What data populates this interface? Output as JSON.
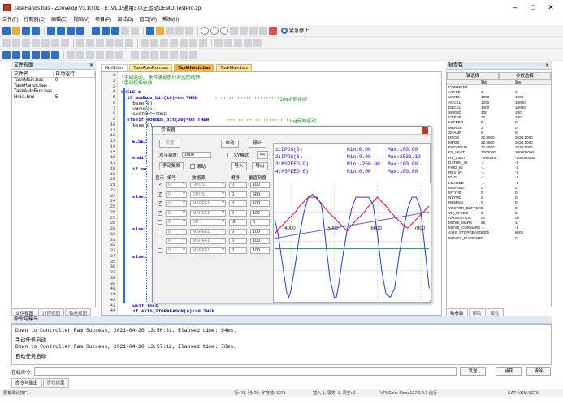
{
  "window": {
    "title": "TaskHands.bas - ZDevelop V3.10.01 - E:\\V1.1\\通用3.0\\正运动DEMO\\TestPro.zpj",
    "minimize": "–",
    "maximize": "□",
    "close": "✕"
  },
  "menu": [
    "文件(F)",
    "控制器(C)",
    "编辑(E)",
    "视图(V)",
    "项目(P)",
    "调试(D)",
    "窗口(W)",
    "帮助(H)"
  ],
  "toolbar": {
    "emergency_label": "紧急停止"
  },
  "file_panel": {
    "title": "文件视图",
    "close": "✕",
    "columns": [
      "文件名",
      "自动运行"
    ],
    "rows": [
      [
        "TaskMain.bas",
        "0"
      ],
      [
        "TaskHands.bas",
        ""
      ],
      [
        "TaskAutoRun.bas",
        ""
      ],
      [
        "Hmi1.hmi",
        "5"
      ]
    ]
  },
  "file_tabs": [
    "文件视图",
    "过程视图",
    "轴参视图"
  ],
  "editor_tabs": [
    "Hmi1.hmi",
    "TaskAutoRun.bas",
    "TaskHands.bas",
    "TaskMain.bas"
  ],
  "editor": {
    "line_numbers": [
      "1",
      "2",
      "3",
      "4",
      "5",
      "6",
      "7",
      "8",
      "9",
      "10",
      "11",
      "12",
      "13",
      "14",
      "15",
      "16",
      "17",
      "18",
      "19",
      "20",
      "21",
      "22",
      "23",
      "24",
      "25",
      "26",
      "27",
      "28",
      "29",
      "30",
      "31",
      "32",
      "33",
      "34",
      "35",
      "36",
      "37",
      "38",
      "39",
      "40",
      "41",
      "42",
      "43",
      "44"
    ],
    "lines": [
      {
        "text": "'手动运动, 条件满足执行对应的动作",
        "cls": "cm",
        "line": 1,
        "indent": 0
      },
      {
        "text": "'手动任务启动",
        "cls": "cm",
        "line": 2,
        "indent": 0
      },
      {
        "text": "WHILE 1",
        "cls": "kw",
        "line": 4,
        "indent": 0
      },
      {
        "text": "if modbus_bit(10)=on THEN",
        "cls": "kw",
        "line": 5,
        "indent": 1
      },
      {
        "text": "'''''''''''''''''''''''Jog正向运动",
        "cls": "cm",
        "line": 5,
        "indent": 32
      },
      {
        "text": "base(0)",
        "cls": "",
        "line": 6,
        "indent": 2
      },
      {
        "text": "VMOVE(1)",
        "cls": "",
        "line": 7,
        "indent": 2
      },
      {
        "text": "SYSTEMP=TRUE",
        "cls": "",
        "line": 8,
        "indent": 2
      },
      {
        "text": "elseif modbus_bit(20)=on THEN",
        "cls": "kw",
        "line": 9,
        "indent": 1
      },
      {
        "text": "''''''''''''''''''''''Jog反向运动",
        "cls": "cm",
        "line": 9,
        "indent": 36
      },
      {
        "text": "base(0)",
        "cls": "",
        "line": 10,
        "indent": 2
      },
      {
        "text": "WAIT IDLE",
        "cls": "kw",
        "line": 43,
        "indent": 2
      },
      {
        "text": "if AXIS_STOPREASON(0)<>0 THEN",
        "cls": "kw",
        "line": 44,
        "indent": 2
      }
    ],
    "folded_labels": [
      {
        "text": "ELSEI",
        "line": 13
      },
      {
        "text": "endif",
        "line": 16
      },
      {
        "text": "if mo",
        "line": 18
      },
      {
        "text": "elsei",
        "line": 23
      },
      {
        "text": "elsei",
        "line": 29
      },
      {
        "text": "elsei",
        "line": 34
      }
    ]
  },
  "scope_dialog": {
    "title": "示波器",
    "settings_btn": "设置",
    "start_btn": "启动",
    "stop_btn": "停止",
    "hscale_label": "水平刻度:",
    "hscale_value": "1000",
    "xy_mode_label": "XY模式",
    "manual_trigger_btn": "手动触发",
    "scroll_label": "滚动",
    "import_btn": "导入",
    "export_btn": "导出",
    "nav_btn": "<<",
    "columns": [
      "显示",
      "编号",
      "数据源",
      "偏移",
      "垂直刻度"
    ],
    "channels": [
      {
        "on": true,
        "num": "0",
        "src": "DPOS",
        "offset": "0",
        "scale": "100"
      },
      {
        "on": true,
        "num": "0",
        "src": "DPOS",
        "offset": "0",
        "scale": "500"
      },
      {
        "on": true,
        "num": "0",
        "src": "MSPEED",
        "offset": "0",
        "scale": "100"
      },
      {
        "on": true,
        "num": "0",
        "src": "MSPEED",
        "offset": "0",
        "scale": "100"
      },
      {
        "on": false,
        "num": "0",
        "src": "DP",
        "offset": "-2",
        "scale": "0"
      },
      {
        "on": false,
        "num": "0",
        "src": "MSPEED",
        "offset": "0",
        "scale": "100"
      },
      {
        "on": false,
        "num": "0",
        "src": "MSPEED",
        "offset": "0",
        "scale": "100"
      },
      {
        "on": false,
        "num": "0",
        "src": "MSPEED",
        "offset": "0",
        "scale": "100"
      }
    ]
  },
  "chart_data": {
    "type": "line",
    "title": "",
    "xlabel": "",
    "ylabel": "",
    "x_ticks": [
      "4000",
      "5000",
      "6000",
      "7000"
    ],
    "xlim": [
      3600,
      7250
    ],
    "ylim": [
      -4,
      4
    ],
    "legend": [
      {
        "name": "1:DPOS(0)",
        "min": "Min:0.00",
        "max": "Max:100.00"
      },
      {
        "name": "2:DPOS(6)",
        "min": "Min:0.00",
        "max": "Max:2533.10"
      },
      {
        "name": "3:MSPEED(0)",
        "min": "Min:-250.00",
        "max": "Max:100.00"
      },
      {
        "name": "4:MSPEED(6)",
        "min": "Min:0.00",
        "max": "Max:100.80"
      }
    ],
    "series": [
      {
        "name": "1:DPOS(0)",
        "color": "#e0003c",
        "x": [
          3620,
          3700,
          3800,
          3900,
          4000,
          4100,
          4200,
          4300,
          4400,
          4500,
          4600,
          4700,
          4800,
          4900,
          5000,
          5100,
          5200,
          5300,
          5400,
          5500,
          5600,
          5700,
          5800,
          5900,
          6000,
          6100,
          6200,
          6300,
          6400,
          6500,
          6600,
          6700,
          6800,
          6900,
          7000,
          7100,
          7200
        ],
        "y": [
          0.5,
          0.8,
          1.1,
          1.4,
          1.7,
          2.0,
          2.4,
          2.7,
          3.0,
          3.2,
          2.9,
          2.6,
          2.2,
          1.9,
          1.6,
          1.3,
          1.0,
          0.7,
          1.1,
          1.4,
          1.7,
          2.0,
          2.4,
          2.7,
          3.0,
          2.7,
          2.4,
          2.0,
          1.7,
          1.4,
          1.1,
          0.9,
          1.2,
          1.5,
          1.8,
          2.1,
          2.4
        ]
      },
      {
        "name": "2:DPOS(6)",
        "color": "#6a5acd",
        "x": [
          3620,
          4200,
          4800,
          5400,
          6000,
          6600,
          7200
        ],
        "y": [
          0.2,
          0.5,
          0.8,
          1.1,
          1.4,
          1.7,
          2.0
        ]
      },
      {
        "name": "3:MSPEED(0)",
        "color": "#1f3fcf",
        "x": [
          3620,
          3700,
          3800,
          3900,
          3950,
          4000,
          4100,
          4200,
          4300,
          4400,
          4500,
          4600,
          4700,
          4750,
          4800,
          4900,
          5000,
          5050,
          5100,
          5200,
          5300,
          5400,
          5500,
          5600,
          5700,
          5800,
          5900,
          6000,
          6100,
          6200,
          6300,
          6400,
          6500,
          6600,
          6700,
          6800,
          6900,
          7000,
          7100,
          7200
        ],
        "y": [
          1.5,
          0.5,
          -1.5,
          -3.5,
          -3.8,
          -3.3,
          -1.5,
          0.5,
          2.0,
          3.0,
          3.0,
          3.0,
          2.5,
          1.5,
          0.0,
          -2.5,
          -3.8,
          -3.8,
          -3.0,
          -1.0,
          0.8,
          2.2,
          3.0,
          3.0,
          3.0,
          3.0,
          2.5,
          0.5,
          -2.0,
          -3.6,
          -3.8,
          -3.2,
          -1.0,
          0.8,
          2.2,
          3.0,
          3.0,
          2.2,
          -0.5,
          -3.2
        ]
      },
      {
        "name": "4:MSPEED(6)",
        "color": "#2e8b57",
        "x": [
          3620,
          4500,
          5400,
          6300,
          7200
        ],
        "y": [
          -0.5,
          -0.5,
          -0.5,
          -0.5,
          -0.5
        ]
      }
    ]
  },
  "param_panel": {
    "title": "轴参数",
    "close": "✕",
    "tabs": [
      "轴选择",
      "参数选择"
    ],
    "col_headers": [
      "",
      "轴0",
      "轴6"
    ],
    "rows": [
      [
        "COMMENT",
        "",
        ""
      ],
      [
        "ATYPE",
        "1",
        "0"
      ],
      [
        "UNITS",
        "1000",
        "1000"
      ],
      [
        "ACCEL",
        "1000",
        "10000"
      ],
      [
        "DECEL",
        "1000",
        "10000"
      ],
      [
        "SPEED",
        "100",
        "100"
      ],
      [
        "CREEP",
        "10",
        "100"
      ],
      [
        "LSPEED",
        "0",
        "0"
      ],
      [
        "MERGE",
        "1",
        "0"
      ],
      [
        "SRAMP",
        "0",
        "0"
      ],
      [
        "DPOS",
        "22.5500",
        "2633.1000"
      ],
      [
        "MPOS",
        "22.5500",
        "2633.1000"
      ],
      [
        "ENDMOVE",
        "22.5500",
        "2633.1000"
      ],
      [
        "FS_LIMIT",
        "2000000",
        "200000000"
      ],
      [
        "RS_LIMIT",
        "-2000000",
        "-200000000"
      ],
      [
        "DATUM_IN",
        "-1",
        "-1"
      ],
      [
        "FWD_IN",
        "-1",
        "-1"
      ],
      [
        "REV_IN",
        "-1",
        "-1"
      ],
      [
        "IDLE",
        "-1",
        "-1"
      ],
      [
        "LOADED",
        "-1",
        "-1"
      ],
      [
        "MSPEED",
        "0",
        "0"
      ],
      [
        "MTYPE",
        "0",
        "0"
      ],
      [
        "NTYPE",
        "0",
        "0"
      ],
      [
        "REMAIN",
        "0",
        "0"
      ],
      [
        "VECTOR_BUFFERED",
        "0",
        "0"
      ],
      [
        "VP_SPEED",
        "0",
        "0"
      ],
      [
        "AXISSTATUS",
        "0h",
        "0h"
      ],
      [
        "MOVE_MARK",
        "56",
        "1"
      ],
      [
        "MOVE_CURMARK",
        "-1",
        "-1"
      ],
      [
        "AXIS_STOPREASON",
        "800h",
        "800h"
      ],
      [
        "MOVES_BUFFERED",
        "0",
        "0"
      ]
    ],
    "bottom_tabs": [
      "轴参数",
      "帮助",
      "属性"
    ]
  },
  "output": {
    "title": "命令与输出",
    "lines": [
      "Down to Controller Ram Success, 2021-04-20 13:56:31, Elapsed time: 94ms.",
      "手动任务启动",
      "Down to Controller Ram Success, 2021-04-20 13:57:12, Elapsed time: 78ms.",
      "自动任务启动"
    ]
  },
  "command": {
    "label": "在线命令:",
    "value": "",
    "send": "发送",
    "capture": "捕获",
    "clear": "清除"
  },
  "bottom_tabs": [
    "命令与输出",
    "查找结果"
  ],
  "status": {
    "left": "要帮助请按F1",
    "pos": "行: 41, 列: 29, 字符数: 1078",
    "mode": "插入  1, 事务: 0, 清空: 0",
    "conn": "VPLCbin: Simu:127.0.0.1  运行",
    "caps": "CAP NUM SCRL"
  }
}
